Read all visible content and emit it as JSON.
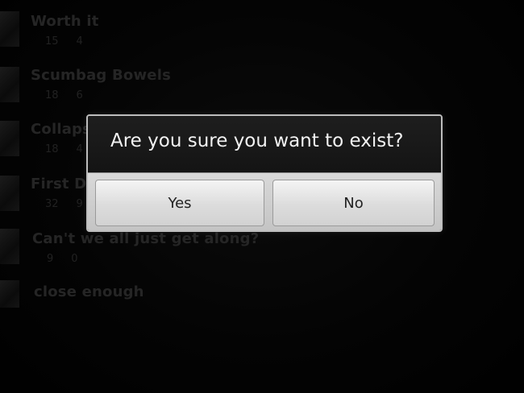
{
  "background_list": {
    "items": [
      {
        "title": "Worth it",
        "counts": [
          "15",
          "4"
        ]
      },
      {
        "title": "Scumbag Bowels",
        "counts": [
          "18",
          "6"
        ]
      },
      {
        "title": "Collapse of civilization",
        "counts": [
          "18",
          "4"
        ]
      },
      {
        "title": "First Da",
        "counts": [
          "32",
          "9"
        ]
      },
      {
        "title": "Can't we all just get along?",
        "counts": [
          "9",
          "0"
        ]
      },
      {
        "title": "close enough",
        "counts": []
      }
    ]
  },
  "dialog": {
    "title": "Are you sure you want to exist?",
    "yes_label": "Yes",
    "no_label": "No"
  },
  "colors": {
    "dialog_header_bg": "#1a1a1a",
    "dialog_footer_bg": "#cfcfcf",
    "title_text": "#f2f2f2"
  }
}
